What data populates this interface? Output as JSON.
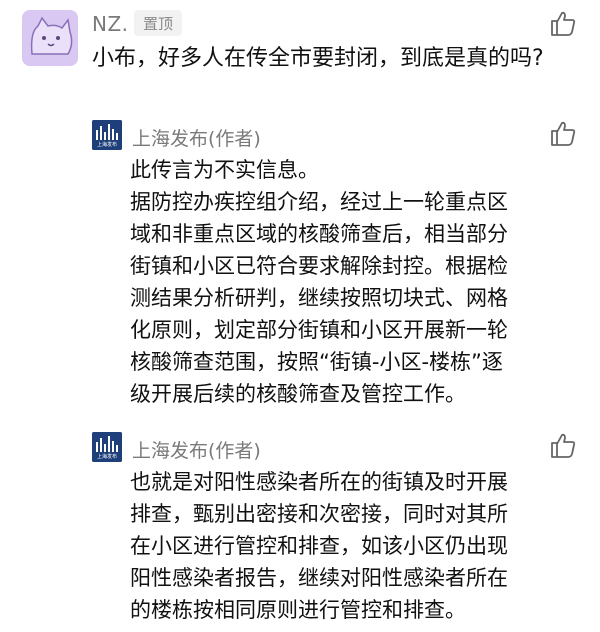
{
  "comment": {
    "author": "NZ.",
    "pin_label": "置顶",
    "text": "小布，好多人在传全市要封闭，到底是真的吗?"
  },
  "replies": [
    {
      "author": "上海发布(作者)",
      "avatar_caption": "上海发布",
      "lines": [
        "此传言为不实信息。",
        "据防控办疾控组介绍，经过上一轮重点区",
        "域和非重点区域的核酸筛查后，相当部分",
        "街镇和小区已符合要求解除封控。根据检",
        "测结果分析研判，继续按照切块式、网格",
        "化原则，划定部分街镇和小区开展新一轮",
        "核酸筛查范围，按照“街镇-小区-楼栋”逐",
        "级开展后续的核酸筛查及管控工作。"
      ]
    },
    {
      "author": "上海发布(作者)",
      "avatar_caption": "上海发布",
      "lines": [
        "也就是对阳性感染者所在的街镇及时开展",
        "排查，甄别出密接和次密接，同时对其所",
        "在小区进行管控和排查，如该小区仍出现",
        "阳性感染者报告，继续对阳性感染者所在",
        "的楼栋按相同原则进行管控和排查。"
      ]
    }
  ]
}
